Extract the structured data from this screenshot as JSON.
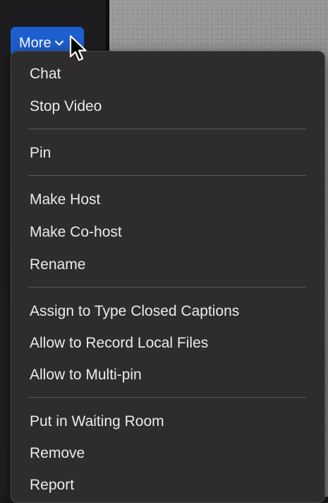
{
  "more_button": {
    "label": "More"
  },
  "menu": {
    "items": [
      {
        "label": "Chat"
      },
      {
        "label": "Stop Video"
      },
      {
        "label": "Pin"
      },
      {
        "label": "Make Host"
      },
      {
        "label": "Make Co-host"
      },
      {
        "label": "Rename"
      },
      {
        "label": "Assign to Type Closed Captions"
      },
      {
        "label": "Allow to Record Local Files"
      },
      {
        "label": "Allow to Multi-pin"
      },
      {
        "label": "Put in Waiting Room"
      },
      {
        "label": "Remove"
      },
      {
        "label": "Report"
      }
    ]
  },
  "colors": {
    "accent": "#1d5fd0",
    "menu_background": "#2e2c2d",
    "menu_text": "#ebebeb",
    "separator": "#58565a"
  },
  "icons": {
    "more_chevron": "chevron-down-icon",
    "cursor": "mouse-pointer-icon"
  }
}
